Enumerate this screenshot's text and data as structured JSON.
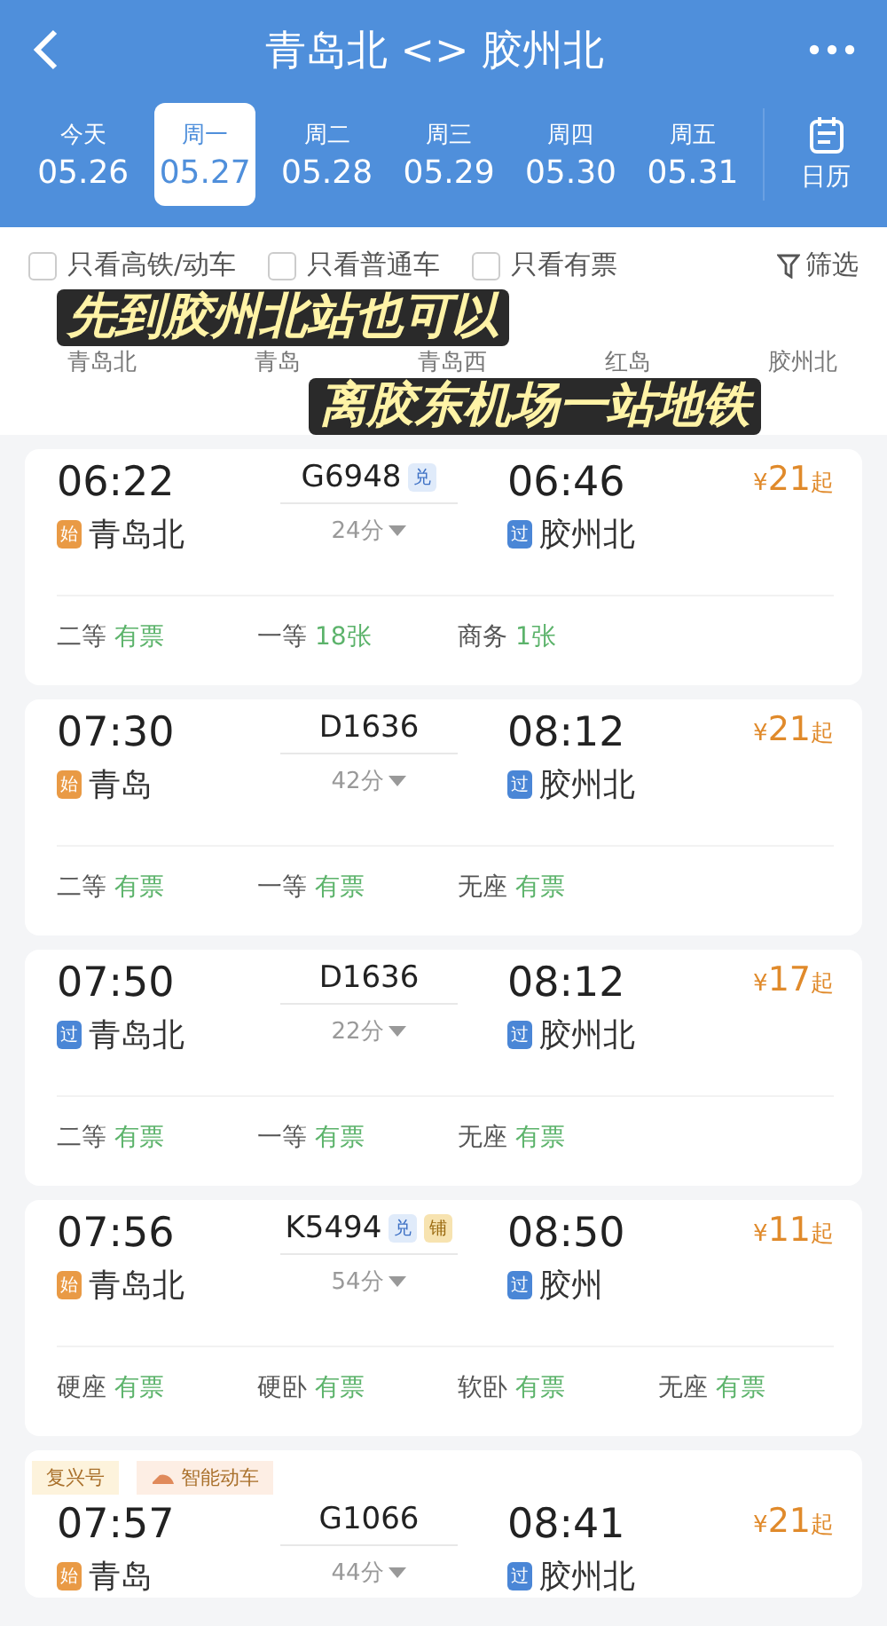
{
  "header": {
    "title": "青岛北 <> 胶州北"
  },
  "dates": [
    {
      "weekday": "今天",
      "date": "05.26",
      "selected": false
    },
    {
      "weekday": "周一",
      "date": "05.27",
      "selected": true
    },
    {
      "weekday": "周二",
      "date": "05.28",
      "selected": false
    },
    {
      "weekday": "周三",
      "date": "05.29",
      "selected": false
    },
    {
      "weekday": "周四",
      "date": "05.30",
      "selected": false
    },
    {
      "weekday": "周五",
      "date": "05.31",
      "selected": false
    }
  ],
  "calendar": {
    "label": "日历"
  },
  "filters": [
    {
      "label": "只看高铁/动车",
      "checked": false
    },
    {
      "label": "只看普通车",
      "checked": false
    },
    {
      "label": "只看有票",
      "checked": false
    }
  ],
  "filter_button": {
    "label": "筛选"
  },
  "captions": [
    "先到胶州北站也可以",
    "离胶东机场一站地铁"
  ],
  "stations": [
    "青岛北",
    "青岛",
    "青岛西",
    "红岛",
    "胶州北"
  ],
  "trains": [
    {
      "depart": "06:22",
      "from": {
        "kind": "start",
        "tag": "始",
        "name": "青岛北"
      },
      "number": "G6948",
      "badges": [
        {
          "kind": "exchange",
          "text": "兑"
        }
      ],
      "duration": "24分",
      "arrive": "06:46",
      "to": {
        "kind": "pass",
        "tag": "过",
        "name": "胶州北"
      },
      "price": {
        "symbol": "¥",
        "amount": "21",
        "suffix": "起"
      },
      "seats": [
        {
          "class": "二等",
          "availability": "有票"
        },
        {
          "class": "一等",
          "availability": "18张"
        },
        {
          "class": "商务",
          "availability": "1张"
        }
      ]
    },
    {
      "depart": "07:30",
      "from": {
        "kind": "start",
        "tag": "始",
        "name": "青岛"
      },
      "number": "D1636",
      "duration": "42分",
      "arrive": "08:12",
      "to": {
        "kind": "pass",
        "tag": "过",
        "name": "胶州北"
      },
      "price": {
        "symbol": "¥",
        "amount": "21",
        "suffix": "起"
      },
      "seats": [
        {
          "class": "二等",
          "availability": "有票"
        },
        {
          "class": "一等",
          "availability": "有票"
        },
        {
          "class": "无座",
          "availability": "有票"
        }
      ]
    },
    {
      "depart": "07:50",
      "from": {
        "kind": "pass",
        "tag": "过",
        "name": "青岛北"
      },
      "number": "D1636",
      "duration": "22分",
      "arrive": "08:12",
      "to": {
        "kind": "pass",
        "tag": "过",
        "name": "胶州北"
      },
      "price": {
        "symbol": "¥",
        "amount": "17",
        "suffix": "起"
      },
      "seats": [
        {
          "class": "二等",
          "availability": "有票"
        },
        {
          "class": "一等",
          "availability": "有票"
        },
        {
          "class": "无座",
          "availability": "有票"
        }
      ]
    },
    {
      "depart": "07:56",
      "from": {
        "kind": "start",
        "tag": "始",
        "name": "青岛北"
      },
      "number": "K5494",
      "badges": [
        {
          "kind": "exchange",
          "text": "兑"
        },
        {
          "kind": "berth",
          "text": "铺"
        }
      ],
      "duration": "54分",
      "arrive": "08:50",
      "to": {
        "kind": "pass",
        "tag": "过",
        "name": "胶州"
      },
      "price": {
        "symbol": "¥",
        "amount": "11",
        "suffix": "起"
      },
      "seats": [
        {
          "class": "硬座",
          "availability": "有票"
        },
        {
          "class": "硬卧",
          "availability": "有票"
        },
        {
          "class": "软卧",
          "availability": "有票"
        },
        {
          "class": "无座",
          "availability": "有票"
        }
      ]
    },
    {
      "tags": [
        {
          "kind": "plain",
          "text": "复兴号"
        },
        {
          "kind": "smart",
          "text": "智能动车"
        }
      ],
      "depart": "07:57",
      "from": {
        "kind": "start",
        "tag": "始",
        "name": "青岛"
      },
      "number": "G1066",
      "duration": "44分",
      "arrive": "08:41",
      "to": {
        "kind": "pass",
        "tag": "过",
        "name": "胶州北"
      },
      "price": {
        "symbol": "¥",
        "amount": "21",
        "suffix": "起"
      }
    }
  ]
}
